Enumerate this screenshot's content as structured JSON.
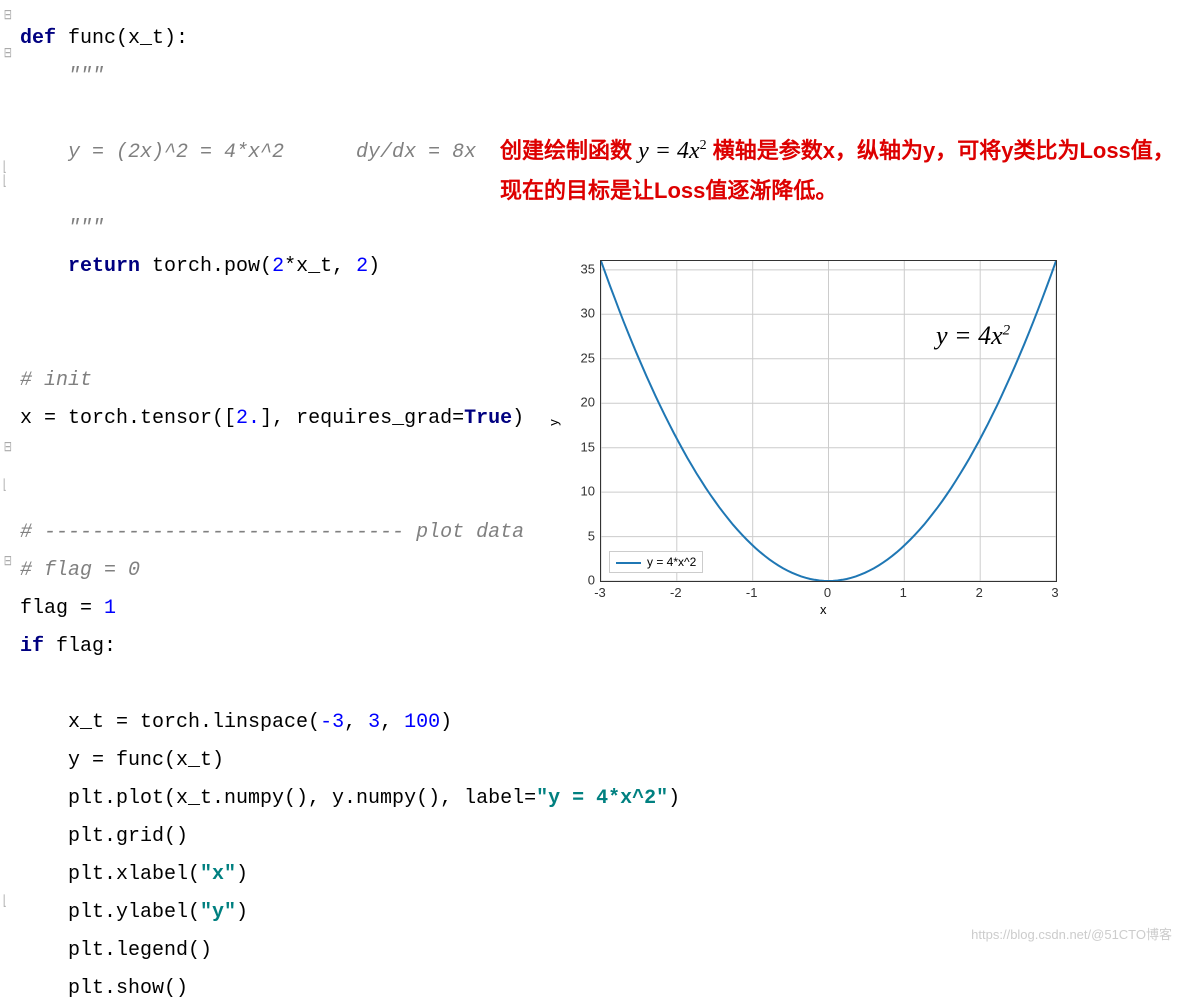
{
  "code": {
    "l1_def": "def",
    "l1_rest": " func(x_t):",
    "l2_doc": "    \"\"\"",
    "l3_doc": "    y = (2x)^2 = 4*x^2      dy/dx = 8x",
    "l4_doc": "    \"\"\"",
    "l5_ret": "    return",
    "l5_rest_a": " torch.pow(",
    "l5_num1": "2",
    "l5_mid": "*x_t, ",
    "l5_num2": "2",
    "l5_end": ")",
    "l7_com": "# init",
    "l8_a": "x = torch.tensor([",
    "l8_num": "2.",
    "l8_b": "], requires_grad=",
    "l8_true": "True",
    "l8_c": ")",
    "l11_com": "# ------------------------------ plot data",
    "l12_com": "# flag = 0",
    "l13_a": "flag = ",
    "l13_num": "1",
    "l14_if": "if",
    "l14_rest": " flag:",
    "l16_a": "    x_t = torch.linspace(",
    "l16_n1": "-3",
    "l16_c1": ", ",
    "l16_n2": "3",
    "l16_c2": ", ",
    "l16_n3": "100",
    "l16_e": ")",
    "l17": "    y = func(x_t)",
    "l18_a": "    plt.plot(x_t.numpy(), y.numpy(), label=",
    "l18_str": "\"y = 4*x^2\"",
    "l18_e": ")",
    "l19": "    plt.grid()",
    "l20_a": "    plt.xlabel(",
    "l20_str": "\"x\"",
    "l20_e": ")",
    "l21_a": "    plt.ylabel(",
    "l21_str": "\"y\"",
    "l21_e": ")",
    "l22": "    plt.legend()",
    "l23": "    plt.show()"
  },
  "annotation": {
    "part1": "创建绘制函数 ",
    "formula": "y = 4x",
    "formula_sup": "2",
    "part2": " 横轴是参数x，纵轴为y，可将y类比为Loss值，现在的目标是让Loss值逐渐降低。"
  },
  "chart": {
    "x_ticks": [
      "-3",
      "-2",
      "-1",
      "0",
      "1",
      "2",
      "3"
    ],
    "y_ticks": [
      "0",
      "5",
      "10",
      "15",
      "20",
      "25",
      "30",
      "35"
    ],
    "xlabel": "x",
    "ylabel": "y",
    "legend": "y = 4*x^2",
    "formula": "y = 4x",
    "formula_sup": "2"
  },
  "chart_data": {
    "type": "line",
    "title": "",
    "xlabel": "x",
    "ylabel": "y",
    "xlim": [
      -3,
      3
    ],
    "ylim": [
      0,
      36
    ],
    "series": [
      {
        "name": "y = 4*x^2",
        "x": [
          -3,
          -2.5,
          -2,
          -1.5,
          -1,
          -0.5,
          0,
          0.5,
          1,
          1.5,
          2,
          2.5,
          3
        ],
        "y": [
          36,
          25,
          16,
          9,
          4,
          1,
          0,
          1,
          4,
          9,
          16,
          25,
          36
        ]
      }
    ],
    "legend_position": "lower left",
    "grid": true
  },
  "watermark": "https://blog.csdn.net/@51CTO博客"
}
